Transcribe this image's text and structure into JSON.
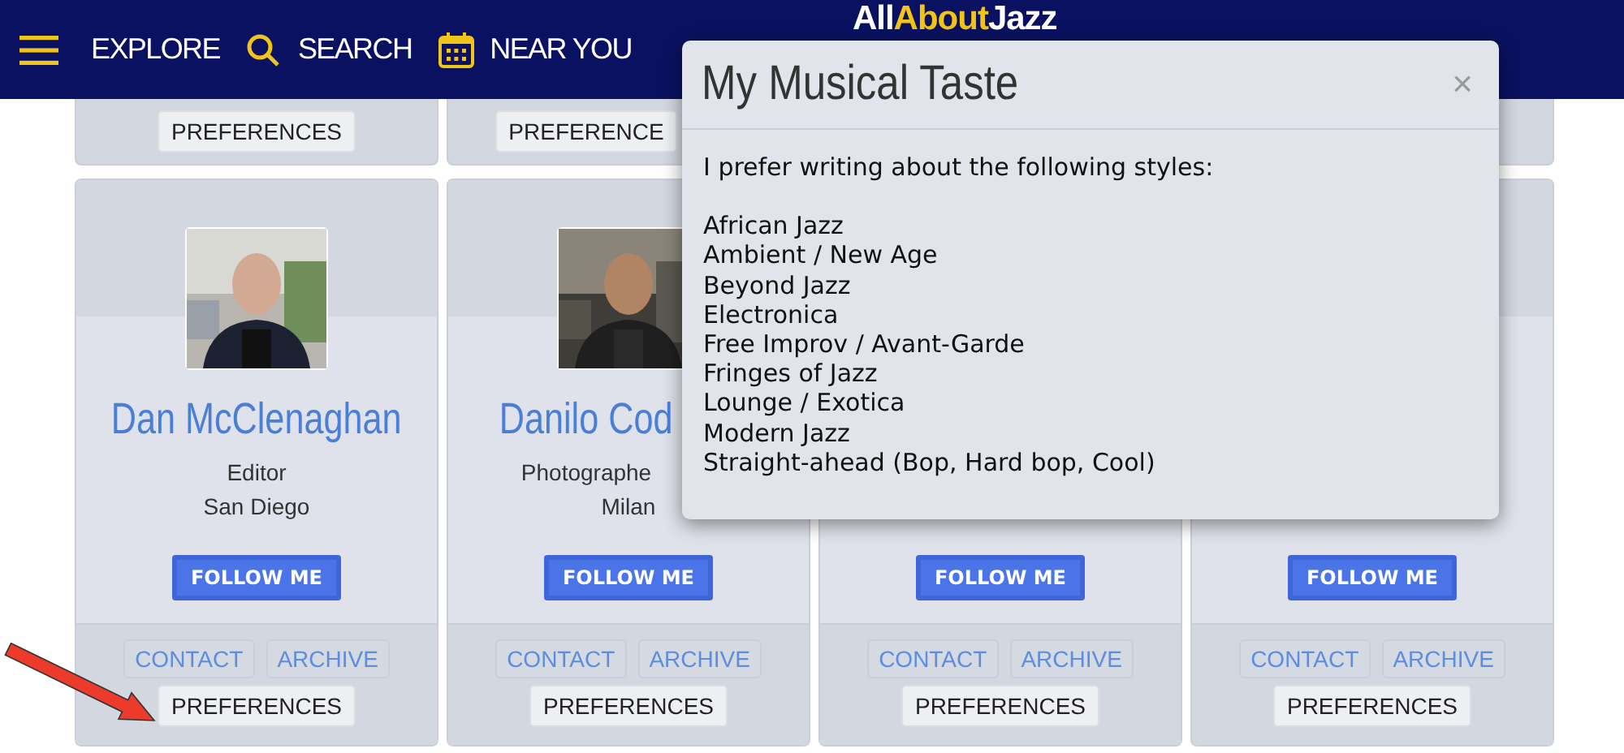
{
  "nav": {
    "items": [
      {
        "label": "EXPLORE"
      },
      {
        "label": "SEARCH"
      },
      {
        "label": "NEAR YOU"
      }
    ],
    "logo": [
      "All",
      "About",
      "Jazz"
    ]
  },
  "top_row": [
    {
      "button": "PREFERENCES"
    },
    {
      "button": "PREFERENCE"
    }
  ],
  "cards": [
    {
      "kind": "profile",
      "name": "Dan McClenaghan",
      "role": "Editor",
      "city": "San Diego",
      "follow": "FOLLOW ME",
      "links": [
        "CONTACT",
        "ARCHIVE"
      ],
      "preferences": "PREFERENCES"
    },
    {
      "kind": "profile",
      "name": "Danilo Cod",
      "role": "Photographe",
      "city": "Milan",
      "follow": "FOLLOW ME",
      "links": [
        "CONTACT",
        "ARCHIVE"
      ],
      "preferences": "PREFERENCES"
    },
    {
      "kind": "covered",
      "follow": "FOLLOW ME",
      "links": [
        "CONTACT",
        "ARCHIVE"
      ],
      "preferences": "PREFERENCES"
    },
    {
      "kind": "covered",
      "follow": "FOLLOW ME",
      "links": [
        "CONTACT",
        "ARCHIVE"
      ],
      "preferences": "PREFERENCES"
    }
  ],
  "modal": {
    "title": "My Musical Taste",
    "close": "×",
    "intro": "I prefer writing about the following styles:",
    "styles": [
      "African Jazz",
      "Ambient / New Age",
      "Beyond Jazz",
      "Electronica",
      "Free Improv / Avant-Garde",
      "Fringes of Jazz",
      "Lounge / Exotica",
      "Modern Jazz",
      "Straight-ahead (Bop, Hard bop, Cool)"
    ]
  }
}
